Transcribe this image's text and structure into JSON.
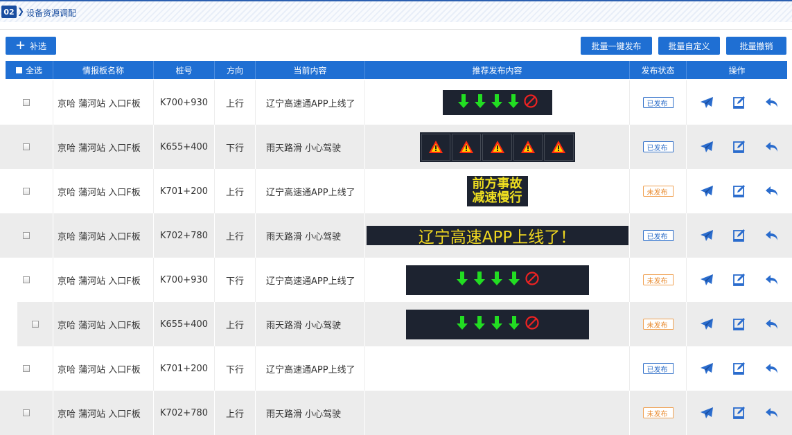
{
  "section": {
    "number": "02",
    "title": "设备资源调配"
  },
  "toolbar": {
    "add_label": "补选",
    "batch_publish": "批量一键发布",
    "batch_custom": "批量自定义",
    "batch_cancel": "批量撤销"
  },
  "columns": {
    "select_all": "全选",
    "name": "情报板名称",
    "pile": "桩号",
    "direction": "方向",
    "current": "当前内容",
    "recommend": "推荐发布内容",
    "status": "发布状态",
    "ops": "操作"
  },
  "rows": [
    {
      "name": "京哈 蒲河站 入口F板",
      "pile": "K700+930",
      "direction": "上行",
      "current": "辽宁高速通APP上线了",
      "status": "已发布",
      "status_type": "published",
      "board": "arrows-small"
    },
    {
      "name": "京哈 蒲河站 入口F板",
      "pile": "K655+400",
      "direction": "下行",
      "current": "雨天路滑 小心驾驶",
      "status": "已发布",
      "status_type": "published",
      "board": "warnings"
    },
    {
      "name": "京哈 蒲河站 入口F板",
      "pile": "K701+200",
      "direction": "上行",
      "current": "辽宁高速通APP上线了",
      "status": "未发布",
      "status_type": "unpublished",
      "board": "text",
      "board_lines": [
        "前方事故",
        "减速慢行"
      ]
    },
    {
      "name": "京哈 蒲河站 入口F板",
      "pile": "K702+780",
      "direction": "上行",
      "current": "雨天路滑 小心驾驶",
      "status": "已发布",
      "status_type": "published",
      "board": "banner",
      "board_text": "辽宁高速APP上线了！"
    },
    {
      "name": "京哈 蒲河站 入口F板",
      "pile": "K700+930",
      "direction": "下行",
      "current": "辽宁高速通APP上线了",
      "status": "未发布",
      "status_type": "unpublished",
      "board": "arrows-wide"
    },
    {
      "name": "京哈 蒲河站 入口F板",
      "pile": "K655+400",
      "direction": "上行",
      "current": "雨天路滑 小心驾驶",
      "status": "未发布",
      "status_type": "unpublished",
      "board": "arrows-wide"
    },
    {
      "name": "京哈 蒲河站 入口F板",
      "pile": "K701+200",
      "direction": "下行",
      "current": "辽宁高速通APP上线了",
      "status": "已发布",
      "status_type": "published",
      "board": "none"
    },
    {
      "name": "京哈 蒲河站 入口F板",
      "pile": "K702+780",
      "direction": "上行",
      "current": "雨天路滑 小心驾驶",
      "status": "未发布",
      "status_type": "unpublished",
      "board": "none"
    }
  ],
  "icons": {
    "publish": "send-icon",
    "edit": "edit-icon",
    "revoke": "undo-icon",
    "arrow": "arrow-down-icon",
    "forbidden": "no-entry-icon",
    "warning": "warning-icon"
  },
  "colors": {
    "primary": "#1f6fd3",
    "published": "#2f6fc9",
    "unpublished": "#e88a2e",
    "led_green": "#22dd22",
    "led_red": "#ee2222",
    "led_yellow": "#f0e020"
  }
}
